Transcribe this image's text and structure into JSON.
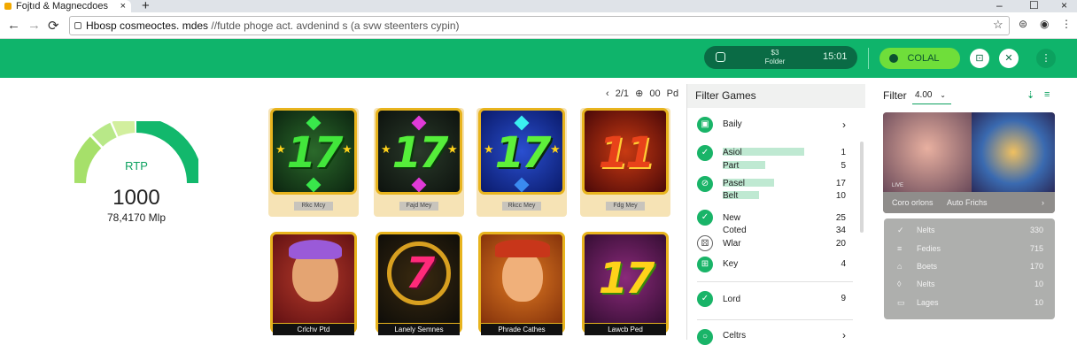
{
  "browser": {
    "tab_title": "Fojtıd & Magnecdoes",
    "url_host": "Hbosp cosmeoctes. mdes",
    "url_path": " //futde phoge act. avdenind s (a svw steenters cypin)"
  },
  "header": {
    "balance_top": "$3",
    "balance_bottom": "Folder",
    "time": "15:01",
    "deposit_label": "COLAL"
  },
  "rtp": {
    "label": "RTP",
    "value": "1000",
    "sub": "78,4170 Mlp"
  },
  "pager": {
    "text": "‹ 2/1 ⊕ 00 Pd"
  },
  "games": {
    "top": [
      {
        "tag": "Rkc Mcy"
      },
      {
        "tag": "Fajd Mey"
      },
      {
        "tag": "Rkcc Mey"
      },
      {
        "tag": "Fdg Mey"
      }
    ],
    "bottom": [
      {
        "caption": "Crlchv Ptd"
      },
      {
        "caption": "Lanely Semnes"
      },
      {
        "caption": "Phrade Cathes"
      },
      {
        "caption": "Lawcb Ped"
      }
    ]
  },
  "filters": {
    "title": "Filter Games",
    "items": [
      {
        "label": "Baily",
        "count": "›"
      },
      {
        "label": "Asiol",
        "count": "1"
      },
      {
        "label": "Part",
        "count": "5"
      },
      {
        "label": "Pasel",
        "count": "17"
      },
      {
        "label": "Belt",
        "count": "10"
      },
      {
        "label": "New",
        "count": "25"
      },
      {
        "label": "Coted",
        "count": "34"
      },
      {
        "label": "Wlar",
        "count": "20"
      },
      {
        "label": "Key",
        "count": "4"
      },
      {
        "label": "Lord",
        "count": "9"
      },
      {
        "label": "Celtrs",
        "count": "›"
      }
    ]
  },
  "side": {
    "filter_label": "Filter",
    "select_value": "4.00",
    "promo_caption_left": "Coro orlons",
    "promo_caption_right": "Auto Frichs",
    "promo_badge": "LIVE",
    "rows": [
      {
        "label": "Nelts",
        "value": "330"
      },
      {
        "label": "Fedies",
        "value": "715"
      },
      {
        "label": "Boets",
        "value": "170"
      },
      {
        "label": "Nelts",
        "value": "10"
      },
      {
        "label": "Lages",
        "value": "10"
      }
    ]
  },
  "colors": {
    "brand": "#0fb46b",
    "dark": "#0a6b45",
    "accent": "#6fde3a",
    "gold": "#e8b41e"
  }
}
